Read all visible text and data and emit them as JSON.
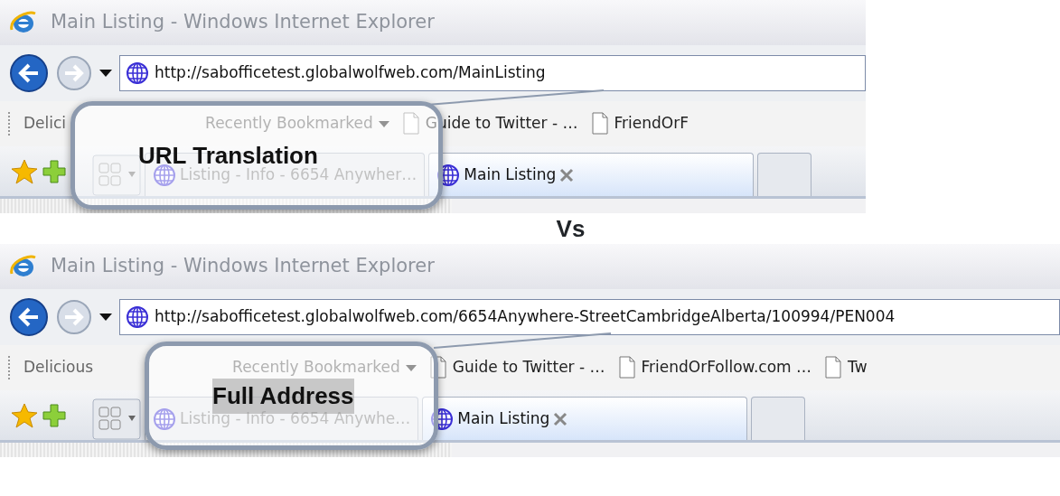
{
  "panels": [
    {
      "window_title": "Main Listing - Windows Internet Explorer",
      "address": "http://sabofficetest.globalwolfweb.com/MainListing",
      "favorites": [
        {
          "label": "Delici",
          "kind": "text"
        },
        {
          "label": "Recently Bookmarked",
          "kind": "dropdown"
        },
        {
          "label": "Guide to Twitter - …",
          "kind": "page"
        },
        {
          "label": "FriendOrF",
          "kind": "page"
        }
      ],
      "tabs": [
        {
          "label": "Listing - Info - 6654 Anywher…",
          "selected": false
        },
        {
          "label": "Main Listing",
          "selected": true
        }
      ],
      "callout": "URL Translation"
    },
    {
      "window_title": "Main Listing - Windows Internet Explorer",
      "address": "http://sabofficetest.globalwolfweb.com/6654Anywhere-StreetCambridgeAlberta/100994/PEN004",
      "favorites": [
        {
          "label": "Delicious",
          "kind": "text"
        },
        {
          "label": "Recently Bookmarked",
          "kind": "dropdown"
        },
        {
          "label": "Guide to Twitter - …",
          "kind": "page"
        },
        {
          "label": "FriendOrFollow.com …",
          "kind": "page"
        },
        {
          "label": "Tw",
          "kind": "page"
        }
      ],
      "tabs": [
        {
          "label": "Listing - Info - 6654 Anywhe…",
          "selected": false
        },
        {
          "label": "Main Listing",
          "selected": true
        }
      ],
      "callout": "Full Address"
    }
  ],
  "separator": "Vs"
}
